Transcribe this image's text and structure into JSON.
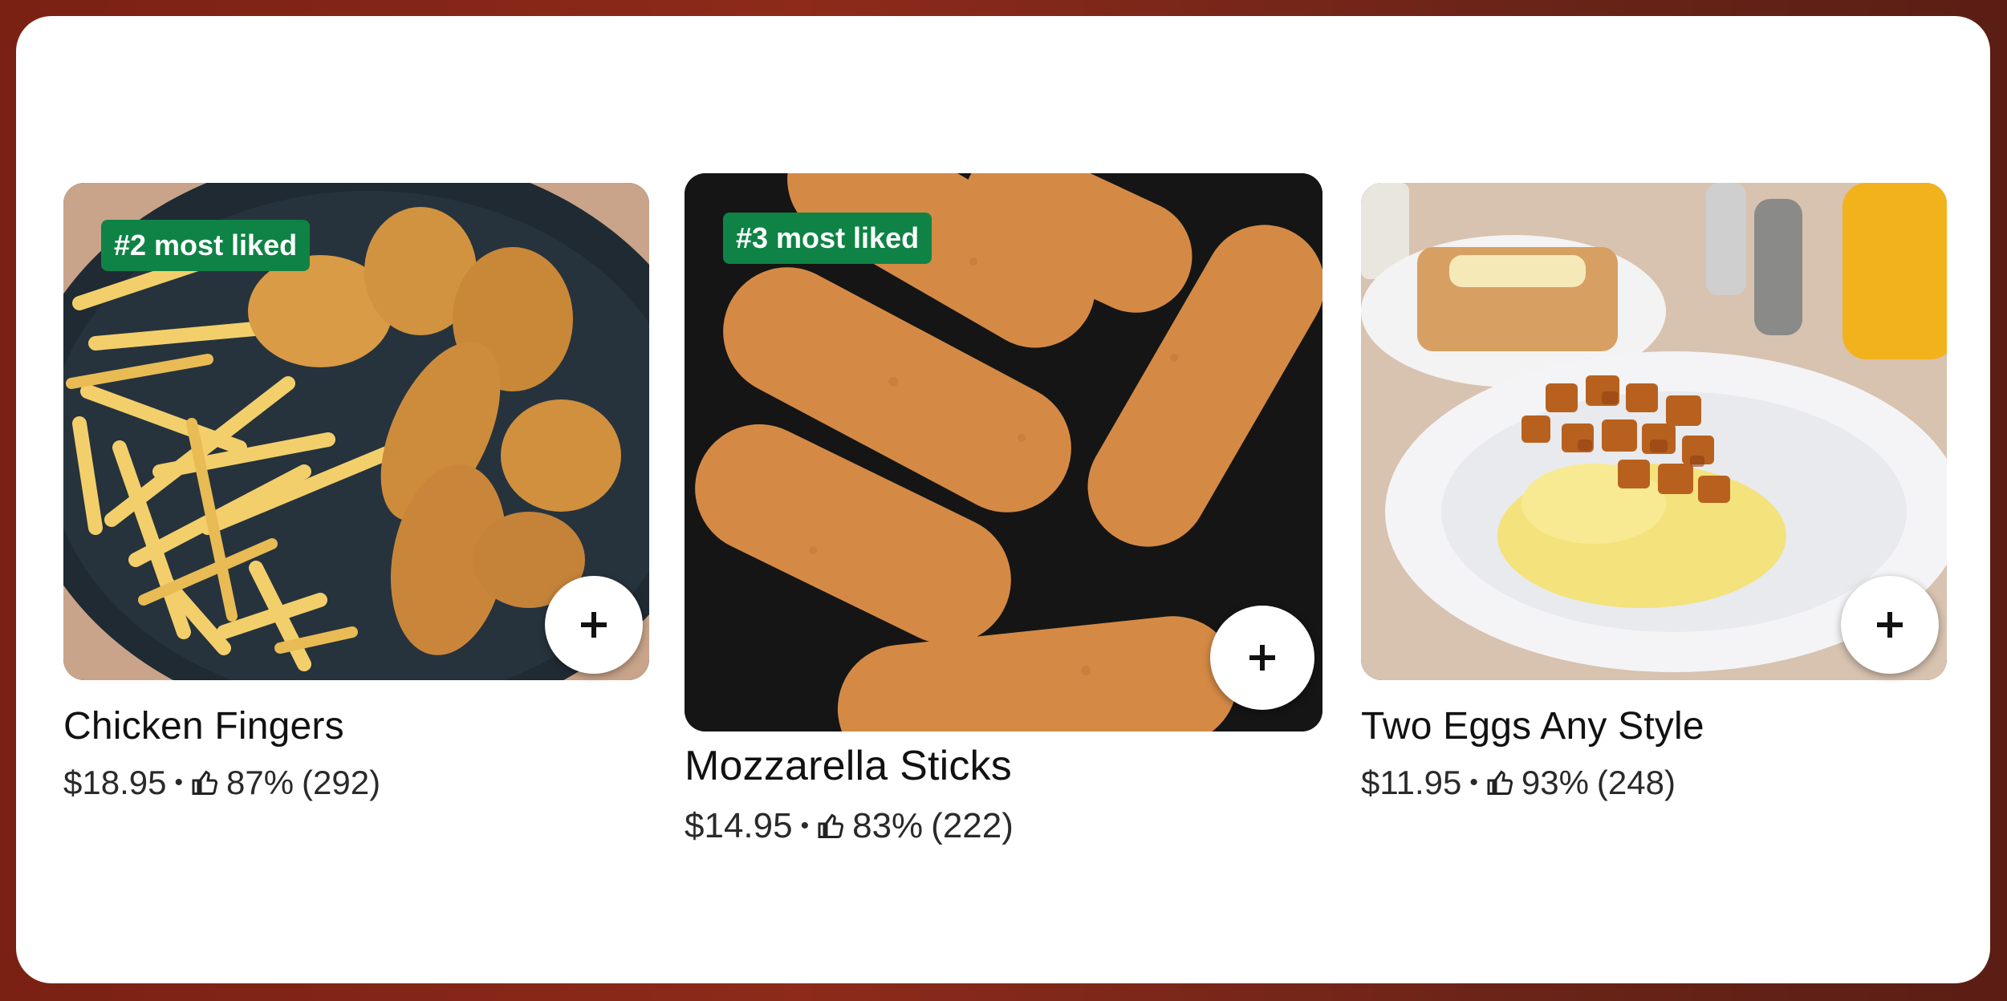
{
  "colors": {
    "badge_bg": "#0e8345",
    "panel_bg": "#ffffff",
    "text": "#111111"
  },
  "items": [
    {
      "name": "Chicken Fingers",
      "price": "$18.95",
      "rating": "87%",
      "count": "(292)",
      "badge": "#2 most liked",
      "add_icon": "plus-icon",
      "rating_icon": "thumbs-up-icon"
    },
    {
      "name": "Mozzarella Sticks",
      "price": "$14.95",
      "rating": "83%",
      "count": "(222)",
      "badge": "#3 most liked",
      "add_icon": "plus-icon",
      "rating_icon": "thumbs-up-icon"
    },
    {
      "name": "Two Eggs Any Style",
      "price": "$11.95",
      "rating": "93%",
      "count": "(248)",
      "badge": "",
      "add_icon": "plus-icon",
      "rating_icon": "thumbs-up-icon"
    }
  ],
  "separator": "•"
}
